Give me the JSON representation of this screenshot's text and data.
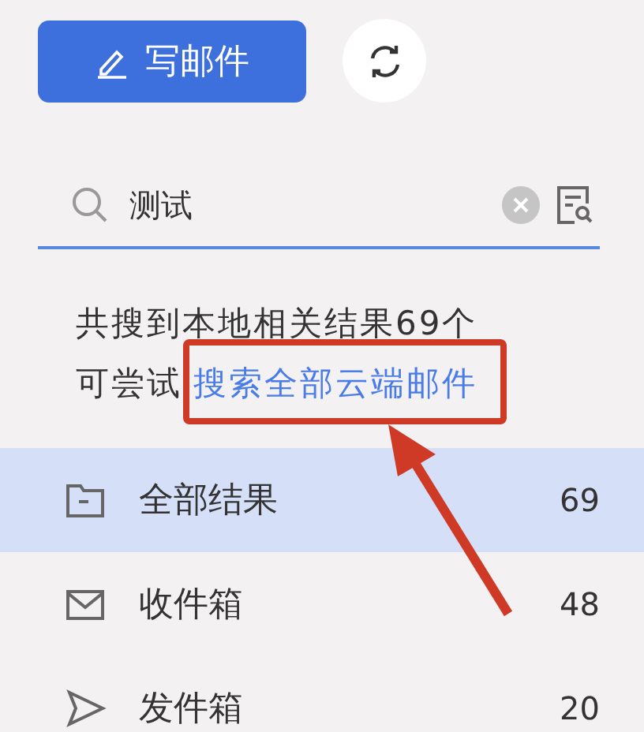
{
  "toolbar": {
    "compose_label": "写邮件"
  },
  "search": {
    "value": "测试"
  },
  "result_summary": {
    "line_1": "共搜到本地相关结果69个",
    "prefix": "可尝试",
    "link": "搜索全部云端邮件"
  },
  "folders": [
    {
      "kind": "all",
      "label": "全部结果",
      "count": "69",
      "selected": true
    },
    {
      "kind": "inbox",
      "label": "收件箱",
      "count": "48",
      "selected": false
    },
    {
      "kind": "sent",
      "label": "发件箱",
      "count": "20",
      "selected": false
    }
  ],
  "annotations": {
    "highlight_box": true,
    "arrow": true
  }
}
